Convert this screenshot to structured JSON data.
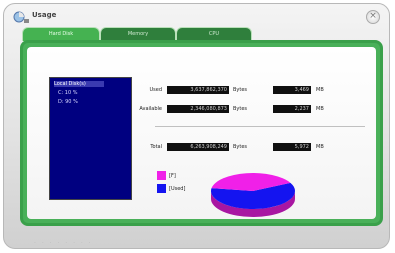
{
  "window": {
    "title": "Usage"
  },
  "tabs": [
    {
      "label": "Hard Disk"
    },
    {
      "label": "Memory"
    },
    {
      "label": "CPU"
    }
  ],
  "drives": [
    {
      "label": "Local Disk(s)",
      "selected": true
    },
    {
      "label": "C: 10 %",
      "selected": false
    },
    {
      "label": "D: 90 %",
      "selected": false
    }
  ],
  "disk": {
    "used": {
      "label": "Used",
      "value": "3,637,862,370",
      "unit": "Bytes",
      "mb": "3,469",
      "mb_unit": "MB"
    },
    "available": {
      "label": "Available",
      "value": "2,346,080,873",
      "unit": "Bytes",
      "mb": "2,237",
      "mb_unit": "MB"
    },
    "total": {
      "label": "Total",
      "value": "6,263,908,249",
      "unit": "Bytes",
      "mb": "5,972",
      "mb_unit": "MB"
    }
  },
  "legend": [
    {
      "label": "[F]",
      "color": "#f020e8"
    },
    {
      "label": "[Used]",
      "color": "#1414f0"
    }
  ],
  "pie": {
    "used_fraction": 0.6,
    "used_color": "#1414f0",
    "available_color": "#f020e8"
  },
  "colors": {
    "accent_green": "#45b251",
    "list_bg": "#000080"
  }
}
